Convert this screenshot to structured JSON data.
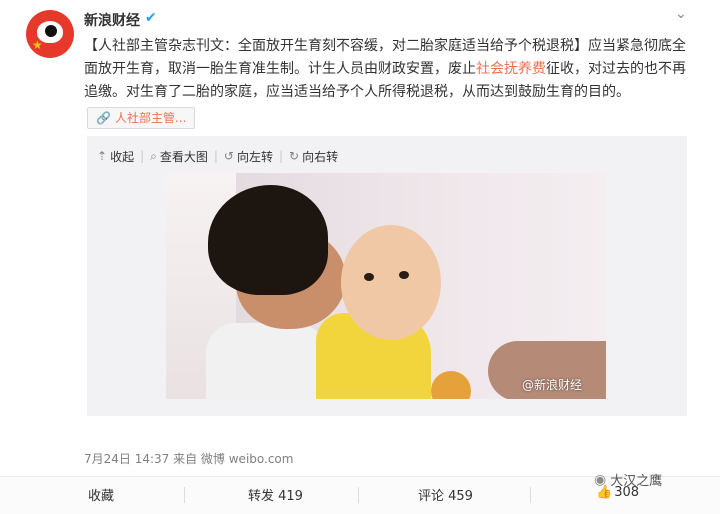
{
  "post": {
    "username": "新浪财经",
    "text_part1": "【人社部主管杂志刊文：全面放开生育刻不容缓，对二胎家庭适当给予个税退税】应当紧急彻底全面放开生育，取消一胎生育准生制。计生人员由财政安置，废止",
    "text_link": "社会抚养费",
    "text_part2": "征收，对过去的也不再追缴。对生育了二胎的家庭，应当适当给予个人所得税退税，从而达到鼓励生育的目的。",
    "tag_chip": "人社部主管...",
    "meta": "7月24日 14:37 来自 微博 weibo.com"
  },
  "media_toolbar": {
    "collapse": "收起",
    "view_large": "查看大图",
    "rotate_left": "向左转",
    "rotate_right": "向右转"
  },
  "photo": {
    "watermark": "@新浪财经"
  },
  "footer": {
    "favorite": "收藏",
    "repost": "转发 419",
    "comment": "评论 459",
    "like_count": "308"
  },
  "overlay": {
    "brand": "大汉之鹰"
  },
  "colors": {
    "link": "#eb7350",
    "verified": "#1da1f2",
    "avatar_bg": "#e7392b"
  },
  "icons": [
    "sina-weibo-avatar",
    "verified-icon",
    "chevron-down-icon",
    "paperclip-icon",
    "collapse-icon",
    "search-icon",
    "rotate-left-icon",
    "rotate-right-icon",
    "thumbs-up-icon",
    "wechat-icon"
  ]
}
